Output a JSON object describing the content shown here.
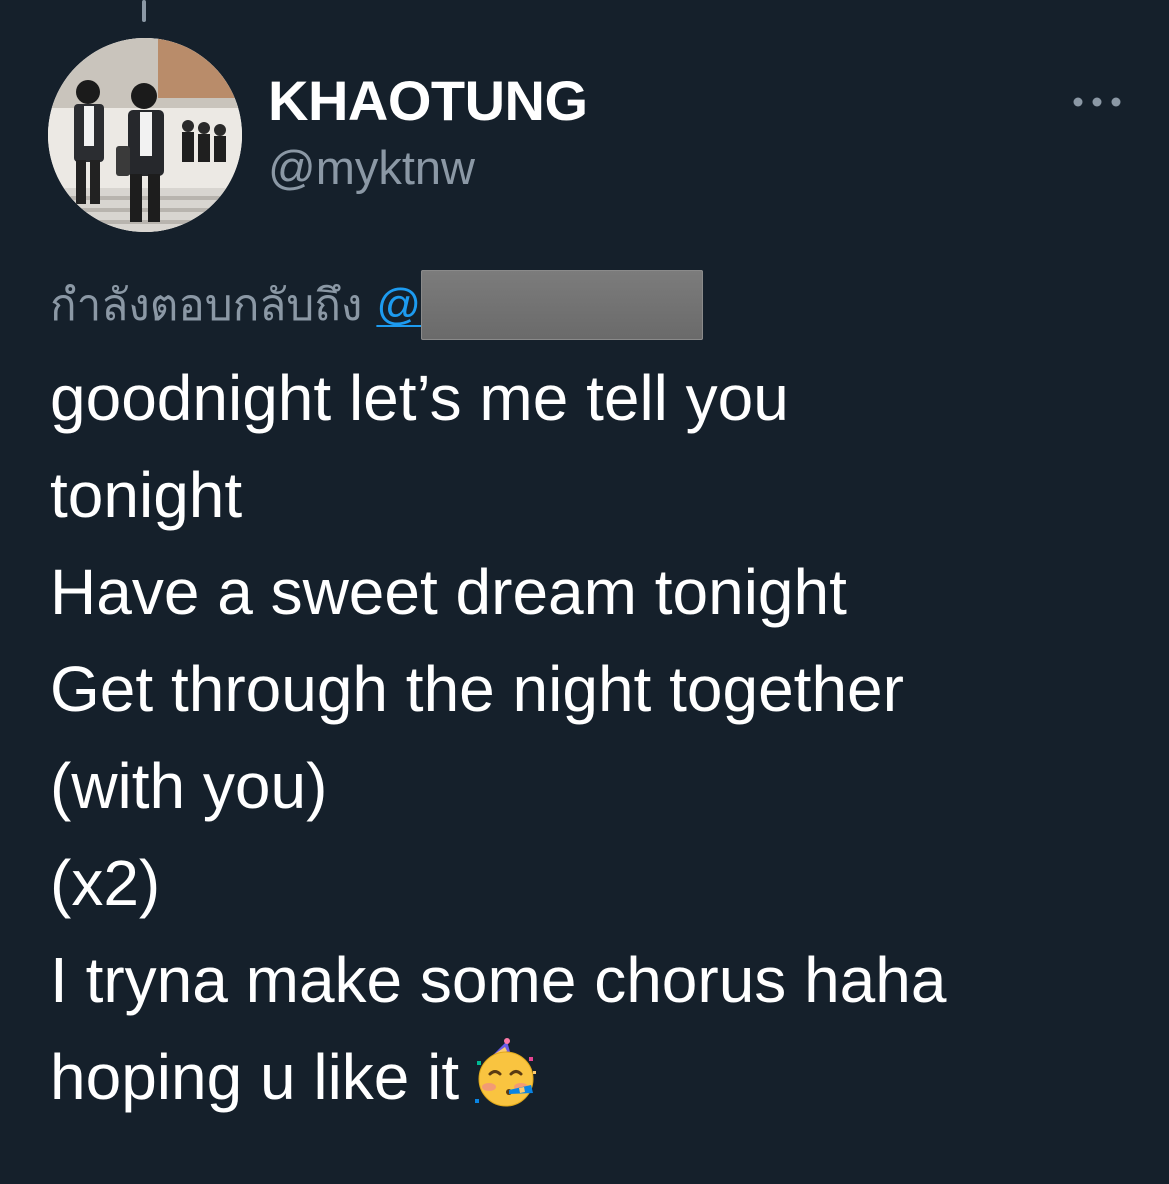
{
  "tweet": {
    "author": {
      "display_name": "KHAOTUNG",
      "handle": "@myktnw"
    },
    "reply_to": {
      "prefix": "กำลังตอบกลับถึง",
      "mention_visible": "@"
    },
    "lines": [
      "goodnight let’s me tell you",
      "tonight",
      "Have a sweet dream tonight",
      "Get through the night together",
      "(with you)",
      "(x2)",
      "I tryna make some chorus  haha",
      "hoping u like it"
    ],
    "emoji_after_last_line": "partying-face-emoji"
  },
  "icons": {
    "more": "more-horizontal-icon"
  },
  "colors": {
    "background": "#15202b",
    "text_primary": "#ffffff",
    "text_secondary": "#8b98a5",
    "link": "#1d9bf0",
    "redaction": "#707070"
  }
}
